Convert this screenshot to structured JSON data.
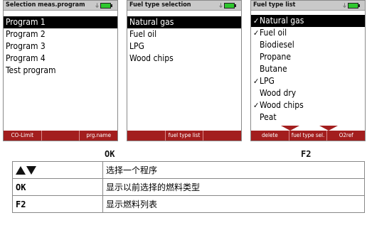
{
  "colors": {
    "softkey_bar": "#a31e1e",
    "battery": "#2ec72e",
    "titlebar": "#c9c9c9"
  },
  "screen1": {
    "title": "Selection meas.program",
    "items": [
      "Program 1",
      "Program 2",
      "Program 3",
      "Program 4",
      "Test program"
    ],
    "softkeys": [
      "CO-Limit",
      "",
      "prg.name"
    ]
  },
  "screen2": {
    "title": "Fuel type selection",
    "items": [
      "Natural gas",
      "Fuel oil",
      "LPG",
      "Wood chips"
    ],
    "softkeys": [
      "",
      "fuel type list",
      ""
    ]
  },
  "screen3": {
    "title": "Fuel type list",
    "items": [
      {
        "label": "Natural gas",
        "checked": true
      },
      {
        "label": "Fuel oil",
        "checked": true
      },
      {
        "label": "Biodiesel",
        "checked": false
      },
      {
        "label": "Propane",
        "checked": false
      },
      {
        "label": "Butane",
        "checked": false
      },
      {
        "label": "LPG",
        "checked": true
      },
      {
        "label": "Wood dry",
        "checked": false
      },
      {
        "label": "Wood chips",
        "checked": true
      },
      {
        "label": "Peat",
        "checked": false
      }
    ],
    "softkeys": [
      "delete",
      "fuel type sel.",
      "O2ref"
    ]
  },
  "captions": {
    "ok": "OK",
    "f2": "F2"
  },
  "legend": [
    {
      "key": "",
      "icon": "up-down-arrows-icon",
      "desc": "选择一个程序"
    },
    {
      "key": "OK",
      "desc": "显示以前选择的燃料类型"
    },
    {
      "key": "F2",
      "desc": "显示燃料列表"
    }
  ]
}
